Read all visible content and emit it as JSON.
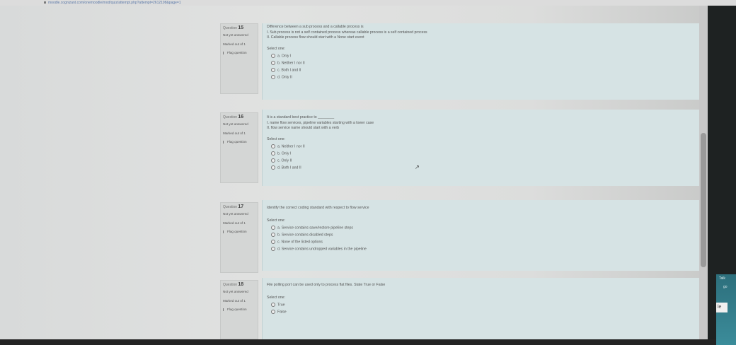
{
  "browser": {
    "url": "moodle.cognizant.com/onemoodle/mod/quiz/attempt.php?attempt=2612198&page=1"
  },
  "quiz": {
    "questions": [
      {
        "label": "Question",
        "number": "15",
        "status": "Not yet answered",
        "marked": "Marked out of 1",
        "flag": "Flag question",
        "text_lines": [
          "Difference between a sub process and a callable process is",
          "I. Sub process is not a self contained process whereas callable process is a self contained process",
          "II. Callable process flow should start with a None start event"
        ],
        "select_label": "Select one:",
        "options": [
          "a. Only I",
          "b. Neither I nor II",
          "c. Both I and II",
          "d. Only II"
        ]
      },
      {
        "label": "Question",
        "number": "16",
        "status": "Not yet answered",
        "marked": "Marked out of 1",
        "flag": "Flag question",
        "text_lines": [
          "It is a standard best practice to ________",
          "I. name flow services, pipeline variables starting with a lower case",
          "II. flow service name should start with a verb"
        ],
        "select_label": "Select one:",
        "options": [
          "a. Neither I nor II",
          "b. Only I",
          "c. Only II",
          "d. Both I and II"
        ]
      },
      {
        "label": "Question",
        "number": "17",
        "status": "Not yet answered",
        "marked": "Marked out of 1",
        "flag": "Flag question",
        "text_lines": [
          "Identify the correct coding standard with respect to flow service"
        ],
        "select_label": "Select one:",
        "options": [
          "a. Service contains save/restore pipeline steps",
          "b. Service contains disabled steps",
          "c. None of the listed options",
          "d. Service contains undropped variables in the pipeline"
        ]
      },
      {
        "label": "Question",
        "number": "18",
        "status": "Not yet answered",
        "marked": "Marked out of 1",
        "flag": "Flag question",
        "text_lines": [
          "File polling port can be used only to process flat files. State True or False"
        ],
        "select_label": "Select one:",
        "options": [
          "True",
          "False"
        ]
      }
    ]
  },
  "side": {
    "t1": "Talk",
    "t2": "go",
    "le": "le"
  }
}
